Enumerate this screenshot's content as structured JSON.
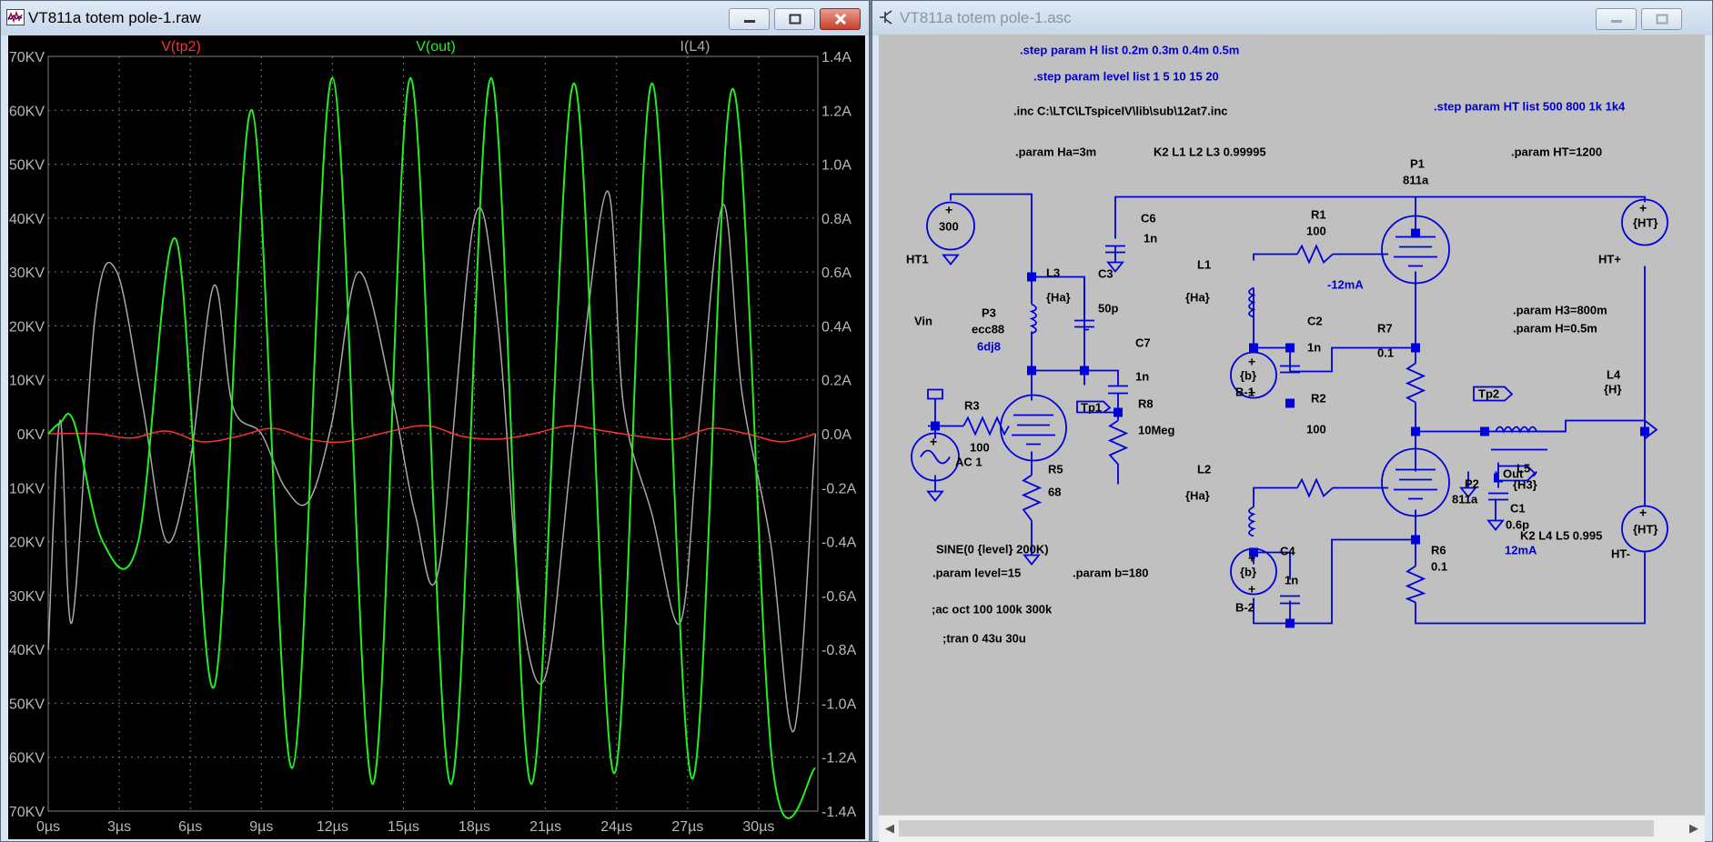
{
  "left_window": {
    "title": "VT811a totem pole-1.raw",
    "min_icon": "minimize-icon",
    "max_icon": "maximize-icon",
    "close_icon": "close-icon"
  },
  "right_window": {
    "title": "VT811a totem pole-1.asc",
    "min_icon": "minimize-icon",
    "max_icon": "maximize-icon",
    "close_icon": "close-icon"
  },
  "colors": {
    "plot_bg": "#000000",
    "v_tp2": "#ff3030",
    "v_out": "#22ee22",
    "i_l4": "#a8a8a8",
    "axis_text": "#b8b8b8",
    "schematic_bg": "#c0c0c0",
    "wire": "#0000dd",
    "label_text": "#000000",
    "annotation_blue": "#0000cc"
  },
  "chart_data": {
    "type": "line",
    "legend": [
      "V(tp2)",
      "V(out)",
      "I(L4)"
    ],
    "x_unit": "µs",
    "x_ticks": [
      "0µs",
      "3µs",
      "6µs",
      "9µs",
      "12µs",
      "15µs",
      "18µs",
      "21µs",
      "24µs",
      "27µs",
      "30µs"
    ],
    "xlim": [
      0,
      32.5
    ],
    "y_left_ticks": [
      "70KV",
      "60KV",
      "50KV",
      "40KV",
      "30KV",
      "20KV",
      "10KV",
      "0KV",
      "-10KV",
      "-20KV",
      "-30KV",
      "-40KV",
      "-50KV",
      "-60KV",
      "-70KV"
    ],
    "ylim_left_kv": [
      -70,
      70
    ],
    "y_right_ticks": [
      "1.4A",
      "1.2A",
      "1.0A",
      "0.8A",
      "0.6A",
      "0.4A",
      "0.2A",
      "0.0A",
      "-0.2A",
      "-0.4A",
      "-0.6A",
      "-0.8A",
      "-1.0A",
      "-1.2A",
      "-1.4A"
    ],
    "ylim_right_a": [
      -1.4,
      1.4
    ],
    "grid": true,
    "series": [
      {
        "name": "V(out)",
        "axis": "left",
        "x": [
          0,
          0.5,
          1.1,
          2.3,
          3.8,
          5.4,
          7.0,
          8.6,
          10.3,
          12.0,
          13.7,
          15.3,
          17.0,
          18.7,
          20.4,
          22.2,
          23.9,
          25.5,
          27.2,
          28.9,
          30.6,
          32.4
        ],
        "y": [
          0,
          2,
          2,
          -20,
          -20,
          36,
          -47,
          60,
          -62,
          66,
          -65,
          66,
          -65,
          66,
          -65,
          65,
          -63,
          65,
          -64,
          64,
          -62,
          -62
        ]
      },
      {
        "name": "V(tp2)",
        "axis": "left",
        "x": [
          0,
          2,
          3.5,
          5,
          6.5,
          8,
          9.5,
          11,
          12.5,
          14.5,
          16,
          17.5,
          19,
          20.5,
          22,
          23.5,
          25,
          26.5,
          28,
          29.5,
          31,
          32.4
        ],
        "y": [
          0,
          0,
          -0.8,
          0.5,
          -1.5,
          -0.5,
          1.0,
          -1.0,
          -1.5,
          0.5,
          1.5,
          -0.5,
          -1.0,
          0,
          1.5,
          0.5,
          -0.5,
          -1.0,
          1.0,
          0,
          -1.5,
          0
        ]
      },
      {
        "name": "I(L4)",
        "axis": "right",
        "x": [
          0,
          0.5,
          1.0,
          2.0,
          2.9,
          4.0,
          5.0,
          6.0,
          7.0,
          7.8,
          9.0,
          10.0,
          11.0,
          12.0,
          13.1,
          14.5,
          15.5,
          16.5,
          18.0,
          19.0,
          19.9,
          21.0,
          22.2,
          23.6,
          24.3,
          25.5,
          26.7,
          27.5,
          28.5,
          29.3,
          30.5,
          31.5,
          32.4
        ],
        "y": [
          -0.8,
          0.05,
          -0.7,
          0.45,
          0.6,
          0.1,
          -0.4,
          -0.1,
          0.55,
          0.1,
          0.0,
          -0.2,
          -0.25,
          0.05,
          0.6,
          0.15,
          -0.3,
          -0.5,
          0.8,
          0.4,
          -0.6,
          -0.9,
          0.0,
          0.9,
          0.1,
          -0.3,
          -0.7,
          0.05,
          0.85,
          0.15,
          -0.4,
          -1.1,
          0.0
        ]
      }
    ]
  },
  "schematic": {
    "directives": [
      {
        "text": ".step param H list 0.2m 0.3m 0.4m 0.5m",
        "color": "blue"
      },
      {
        "text": ".step param level list 1 5 10 15 20",
        "color": "blue"
      },
      {
        "text": ".inc C:\\LTC\\LTspiceIV\\lib\\sub\\12at7.inc",
        "color": "black"
      },
      {
        "text": ".step param HT list 500 800 1k 1k4",
        "color": "blue"
      },
      {
        "text": ".param Ha=3m",
        "color": "black"
      },
      {
        "text": "K2 L1 L2 L3 0.99995",
        "color": "black"
      },
      {
        "text": ".param HT=1200",
        "color": "black"
      },
      {
        "text": ".param H3=800m",
        "color": "black"
      },
      {
        "text": ".param H=0.5m",
        "color": "black"
      },
      {
        "text": "SINE(0 {level} 200K)",
        "color": "black"
      },
      {
        "text": ".param level=15",
        "color": "black"
      },
      {
        "text": ".param b=180",
        "color": "black"
      },
      {
        "text": ";ac oct 100 100k 300k",
        "color": "black"
      },
      {
        "text": ";tran 0 43u 30u",
        "color": "black"
      },
      {
        "text": "K2 L4 L5  0.995",
        "color": "black"
      }
    ],
    "labels": {
      "p1": "P1",
      "p1v": "811a",
      "p2": "P2",
      "p2v": "811a",
      "p3": "P3",
      "p3v": "ecc88",
      "p3b": "6dj8",
      "r1": "R1",
      "r1v": "100",
      "r2": "R2",
      "r2v": "100",
      "r3": "R3",
      "r3v": "100",
      "r5": "R5",
      "r5v": "68",
      "r6": "R6",
      "r6v": "0.1",
      "r7": "R7",
      "r7v": "0.1",
      "r8": "R8",
      "r8v": "10Meg",
      "c1": "C1",
      "c1v": "0.6p",
      "c2": "C2",
      "c2v": "1n",
      "c3": "C3",
      "c3v": "50p",
      "c4": "C4",
      "c4v": "1n",
      "c6": "C6",
      "c6v": "1n",
      "c7": "C7",
      "c7v": "1n",
      "l1": "L1",
      "l1v": "{Ha}",
      "l2": "L2",
      "l2v": "{Ha}",
      "l3": "L3",
      "l3v": "{Ha}",
      "l4": "L4",
      "l4v": "{H}",
      "l5": "L5",
      "l5v": "{H3}",
      "ht1": "HT1",
      "ht1v": "300",
      "htp": "HT+",
      "htm": "HT-",
      "htv": "{HT}",
      "b1": "B-1",
      "b2": "B-2",
      "bv": "{b}",
      "vin": "Vin",
      "ac": "AC 1",
      "tp1": "Tp1",
      "tp2": "Tp2",
      "out": "Out",
      "i1": "-12mA",
      "i2": "12mA"
    }
  }
}
